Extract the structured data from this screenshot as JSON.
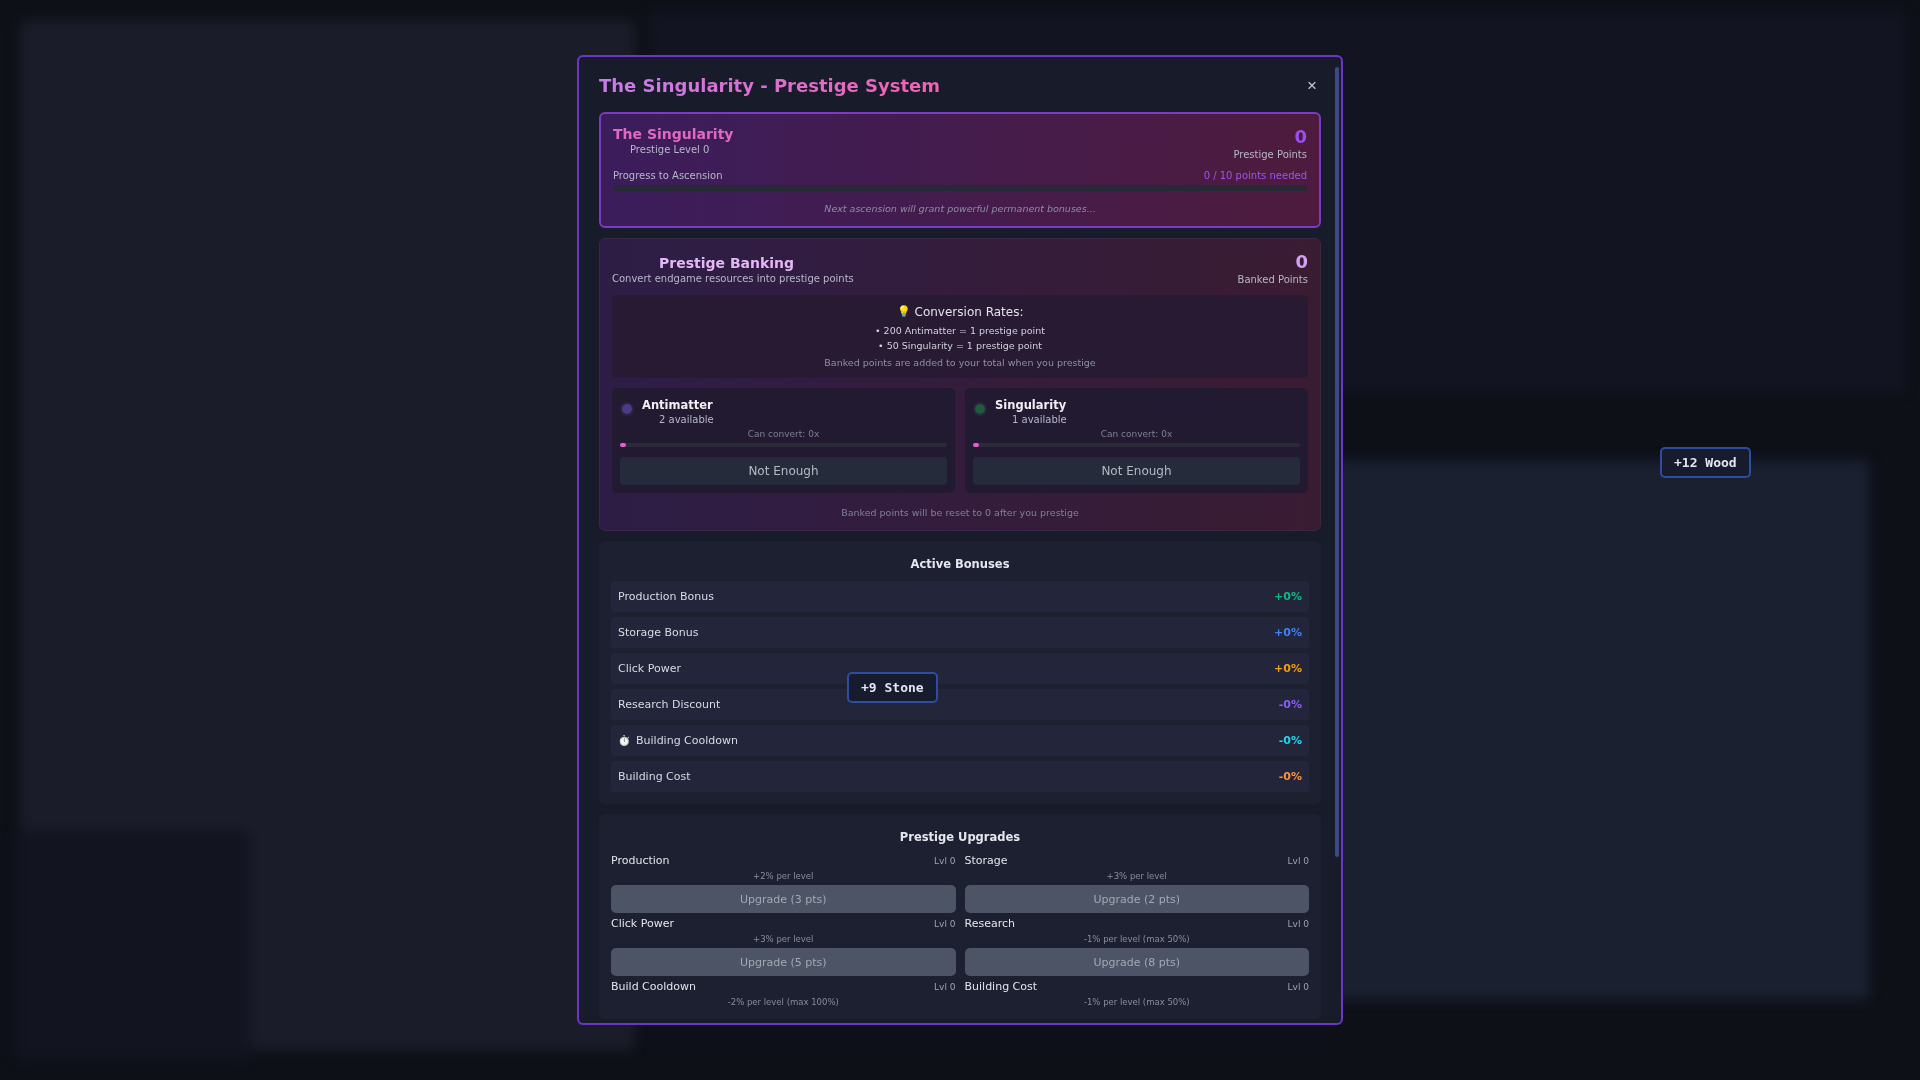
{
  "modal": {
    "title": "The Singularity - Prestige System",
    "close": "×"
  },
  "singularity": {
    "title": "The Singularity",
    "level_label": "Prestige Level 0",
    "points": "0",
    "points_label": "Prestige Points",
    "progress_label": "Progress to Ascension",
    "progress_text": "0 / 10 points needed",
    "level": 0,
    "note": "Next ascension will grant powerful permanent bonuses..."
  },
  "banking": {
    "title": "Prestige Banking",
    "subtitle": "Convert endgame resources into prestige points",
    "points": "0",
    "points_label": "Banked Points",
    "rates_icon": "💡",
    "rates_title": "Conversion Rates:",
    "rates": [
      "• 200 Antimatter = 1 prestige point",
      "• 50 Singularity = 1 prestige point"
    ],
    "rates_note": "Banked points are added to your total when you prestige",
    "resources": [
      {
        "name": "Antimatter",
        "available": "2 available",
        "convert": "Can convert: 0x",
        "level": 0,
        "button": "Not Enough",
        "disabled": true,
        "color": "#4c3a8a"
      },
      {
        "name": "Singularity",
        "available": "1 available",
        "convert": "Can convert: 0x",
        "level": 0,
        "button": "Not Enough",
        "disabled": true,
        "color": "#1f5a3a"
      }
    ],
    "footer": "Banked points will be reset to 0 after you prestige"
  },
  "bonuses": {
    "title": "Active Bonuses",
    "items": [
      {
        "label": "Production Bonus",
        "value": "+0%",
        "color": "#10b981"
      },
      {
        "label": "Storage Bonus",
        "value": "+0%",
        "color": "#3b82f6"
      },
      {
        "label": "Click Power",
        "value": "+0%",
        "color": "#f59e0b"
      },
      {
        "label": "Research Discount",
        "value": "-0%",
        "color": "#8b5cf6"
      },
      {
        "label": "Building Cooldown",
        "value": "-0%",
        "color": "#22d3ee",
        "icon": "⏱️"
      },
      {
        "label": "Building Cost",
        "value": "-0%",
        "color": "#fb923c"
      }
    ]
  },
  "upgrades": {
    "title": "Prestige Upgrades",
    "items": [
      {
        "name": "Production",
        "level": "Lvl 0",
        "desc": "+2% per level",
        "button": "Upgrade (3 pts)",
        "disabled": true
      },
      {
        "name": "Storage",
        "level": "Lvl 0",
        "desc": "+3% per level",
        "button": "Upgrade (2 pts)",
        "disabled": true
      },
      {
        "name": "Click Power",
        "level": "Lvl 0",
        "desc": "+3% per level",
        "button": "Upgrade (5 pts)",
        "disabled": true
      },
      {
        "name": "Research",
        "level": "Lvl 0",
        "desc": "-1% per level (max 50%)",
        "button": "Upgrade (8 pts)",
        "disabled": true
      },
      {
        "name": "Build Cooldown",
        "level": "Lvl 0",
        "desc": "-2% per level (max 100%)"
      },
      {
        "name": "Building Cost",
        "level": "Lvl 0",
        "desc": "-1% per level (max 50%)"
      }
    ]
  },
  "toasts": [
    {
      "text": "+12 Wood"
    },
    {
      "text": "+9 Stone"
    }
  ]
}
